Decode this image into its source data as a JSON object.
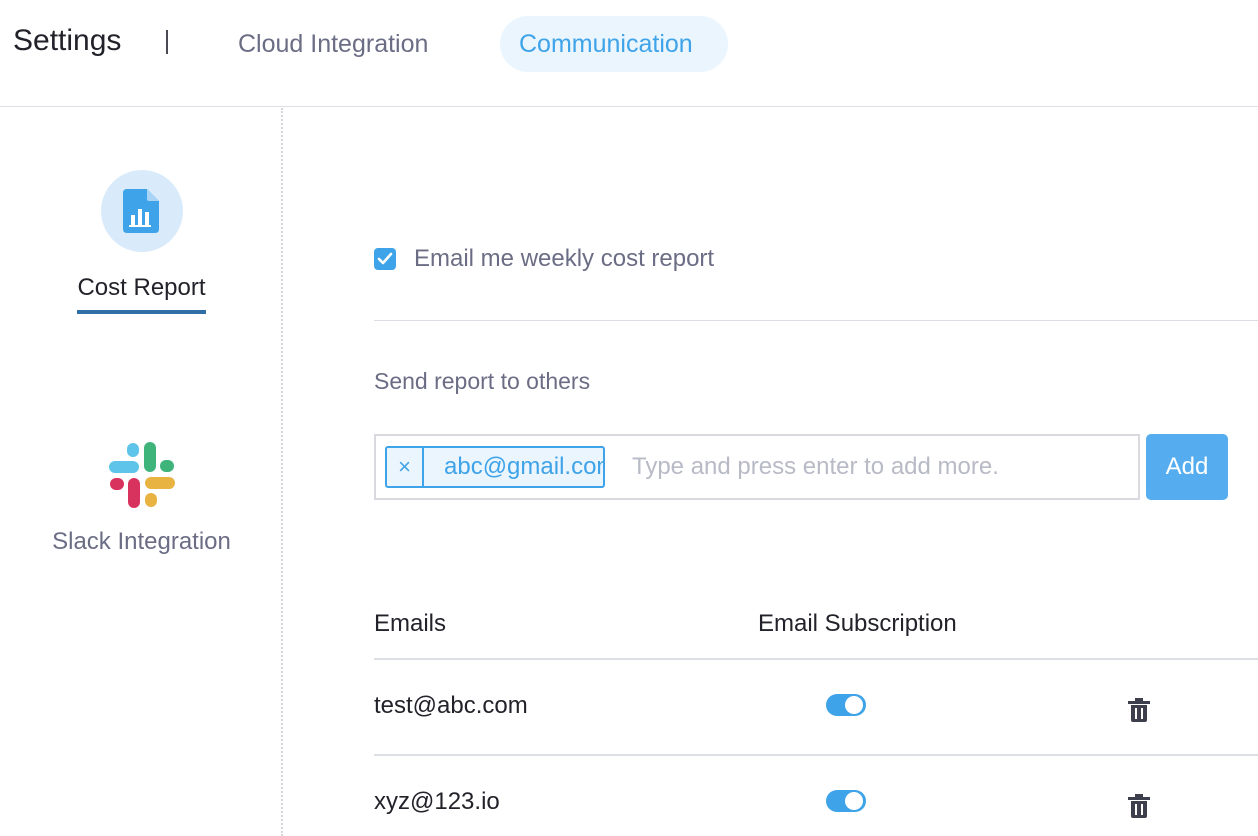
{
  "header": {
    "title": "Settings",
    "tabs": [
      {
        "label": "Cloud Integration",
        "active": false
      },
      {
        "label": "Communication",
        "active": true
      }
    ]
  },
  "sidebar": {
    "items": [
      {
        "label": "Cost Report",
        "icon": "report-chart-icon",
        "active": true
      },
      {
        "label": "Slack Integration",
        "icon": "slack-logo-icon",
        "active": false
      }
    ]
  },
  "main": {
    "weekly_report": {
      "label": "Email me weekly cost report",
      "checked": true
    },
    "send_label": "Send report to others",
    "recipients": {
      "chips": [
        "abc@gmail.com"
      ],
      "placeholder": "Type and press enter to add more.",
      "add_label": "Add"
    },
    "table": {
      "columns": [
        "Emails",
        "Email Subscription"
      ],
      "rows": [
        {
          "email": "test@abc.com",
          "subscribed": true
        },
        {
          "email": "xyz@123.io",
          "subscribed": true
        }
      ]
    }
  },
  "colors": {
    "accent": "#3ea3e8",
    "active_tab_bg": "#eaf5fd",
    "active_underline": "#2f6ea6",
    "add_button": "#55adef"
  }
}
